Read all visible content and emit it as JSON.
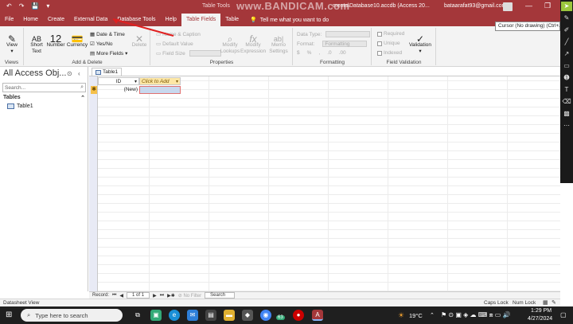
{
  "titlebar": {
    "undo": "↶",
    "redo": "↷",
    "save": "💾",
    "tabletools": "Table Tools",
    "watermark": "www.BANDICAM.com",
    "doc_title": "ments\\Database10.accdb (Access 20...",
    "user": "bataarafat93@gmail.com",
    "min": "—",
    "restore": "❐",
    "close": "✕"
  },
  "tabs": [
    "File",
    "Home",
    "Create",
    "External Data",
    "Database Tools",
    "Help",
    "Table Fields",
    "Table"
  ],
  "active_tab": "Table Fields",
  "tell": "Tell me what you want to do",
  "ribbon": {
    "views": {
      "view": "View",
      "group": "Views"
    },
    "adddelete": {
      "short_text": "Short Text",
      "number": "Number",
      "currency": "Currency",
      "date_time": "Date & Time",
      "yes_no": "Yes/No",
      "more_fields": "More Fields",
      "delete": "Delete",
      "group": "Add & Delete",
      "ab_icon": "AB",
      "num_icon": "12"
    },
    "properties": {
      "name_caption": "Name & Caption",
      "default_value": "Default Value",
      "field_size": "Field Size",
      "modify_lookups": "Modify Lookups",
      "modify_expression": "Modify Expression",
      "memo_settings": "Memo Settings",
      "group": "Properties"
    },
    "formatting": {
      "data_type": "Data Type:",
      "format": "Format:",
      "format_value": "Formatting",
      "dollar": "$",
      "percent": "%",
      "comma": ",",
      "dec_up": ".0",
      "dec_down": ".00",
      "group": "Formatting"
    },
    "validation": {
      "required": "Required",
      "unique": "Unique",
      "indexed": "Indexed",
      "validation": "Validation",
      "group": "Field Validation"
    }
  },
  "nav": {
    "title": "All Access Obj...",
    "search_placeholder": "Search...",
    "section": "Tables",
    "items": [
      "Table1"
    ]
  },
  "document": {
    "tab": "Table1",
    "columns": [
      "ID",
      "Click to Add"
    ],
    "new_row": "(New)"
  },
  "recnav": {
    "label": "Record:",
    "first": "⏮",
    "prev": "◀",
    "position": "1 of 1",
    "next": "▶",
    "last": "⏭",
    "filter": "No Filter",
    "search": "Search"
  },
  "status": {
    "left": "Datasheet View",
    "caps": "Caps Lock",
    "num": "Num Lock"
  },
  "taskbar": {
    "search": "Type here to search",
    "temp": "19°C",
    "time": "1:29 PM",
    "date": "4/27/2024",
    "badge": "63"
  },
  "tooltip": "Cursor (No drawing) (Ctrl+A)",
  "colors": {
    "accent": "#a4373a",
    "ribbon": "#f3f3f3",
    "taskbar": "#1f1f1f"
  }
}
